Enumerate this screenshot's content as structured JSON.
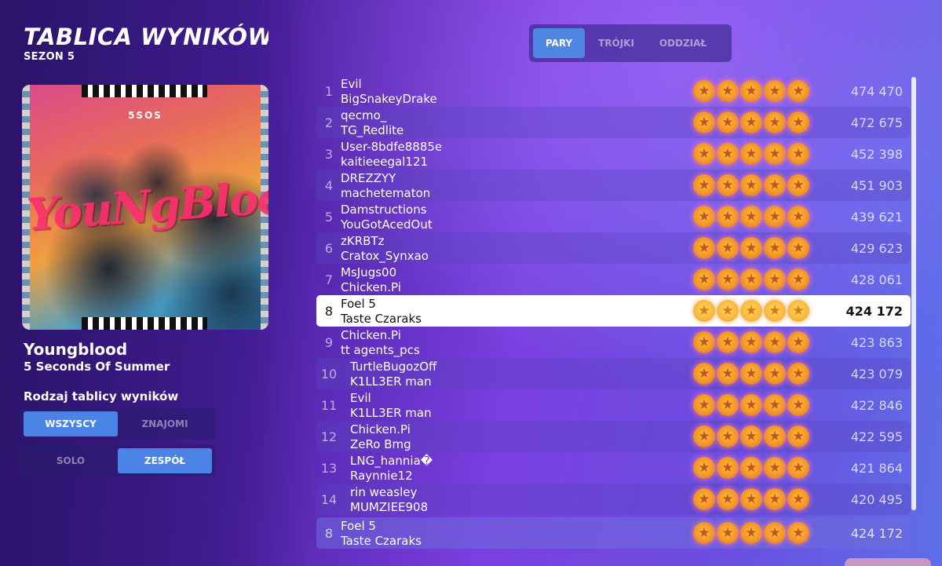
{
  "header": {
    "title": "TABLICA WYNIKÓW",
    "season": "SEZON 5"
  },
  "album": {
    "band_logo": "5SOS",
    "cover_script": "YouNgBlooD"
  },
  "song": {
    "title": "Youngblood",
    "artist": "5 Seconds Of Summer"
  },
  "board_type": {
    "label": "Rodzaj tablicy wyników",
    "scope": [
      {
        "label": "WSZYSCY",
        "active": true
      },
      {
        "label": "ZNAJOMI",
        "active": false
      }
    ],
    "mode": [
      {
        "label": "SOLO",
        "active": false
      },
      {
        "label": "ZESPÓŁ",
        "active": true
      }
    ]
  },
  "tabs": [
    {
      "label": "PARY",
      "active": true
    },
    {
      "label": "TRÓJKI",
      "active": false
    },
    {
      "label": "ODDZIAŁ",
      "active": false
    }
  ],
  "rows": [
    {
      "rank": "1",
      "player1": "Evil",
      "player2": "BigSnakeyDrake",
      "score": "474 470",
      "stars": 5
    },
    {
      "rank": "2",
      "player1": "qecmo_",
      "player2": "TG_Redlite",
      "score": "472 675",
      "stars": 5
    },
    {
      "rank": "3",
      "player1": "User-8bdfe8885e",
      "player2": "kaitieeegal121",
      "score": "452 398",
      "stars": 5
    },
    {
      "rank": "4",
      "player1": "DREZZYY",
      "player2": "machetematon",
      "score": "451 903",
      "stars": 5
    },
    {
      "rank": "5",
      "player1": "Damstructions",
      "player2": "YouGotAcedOut",
      "score": "439 621",
      "stars": 5
    },
    {
      "rank": "6",
      "player1": "zKRBTz",
      "player2": "Cratox_Synxao",
      "score": "429 623",
      "stars": 5
    },
    {
      "rank": "7",
      "player1": "MsJugs00",
      "player2": "Chicken.Pi",
      "score": "428 061",
      "stars": 5
    },
    {
      "rank": "8",
      "player1": "Foel 5",
      "player2": "Taste Czaraks",
      "score": "424 172",
      "stars": 5,
      "highlight": true
    },
    {
      "rank": "9",
      "player1": "Chicken.Pi",
      "player2": "tt agents_pcs",
      "score": "423 863",
      "stars": 5
    },
    {
      "rank": "10",
      "player1": "TurtleBugozOff",
      "player2": "K1LL3ER man",
      "score": "423 079",
      "stars": 5
    },
    {
      "rank": "11",
      "player1": "Evil",
      "player2": "K1LL3ER man",
      "score": "422 846",
      "stars": 5
    },
    {
      "rank": "12",
      "player1": "Chicken.Pi",
      "player2": "ZeRo Bmg",
      "score": "422 595",
      "stars": 5
    },
    {
      "rank": "13",
      "player1": "LNG_hannia�",
      "player2": "Raynnie12",
      "score": "421 864",
      "stars": 5
    },
    {
      "rank": "14",
      "player1": "rin weasley",
      "player2": "MUMZIEE908",
      "score": "420 495",
      "stars": 5
    }
  ],
  "my_row": {
    "rank": "8",
    "player1": "Foel 5",
    "player2": "Taste Czaraks",
    "score": "424 172",
    "stars": 5
  },
  "icons": {
    "star": "star-icon"
  }
}
